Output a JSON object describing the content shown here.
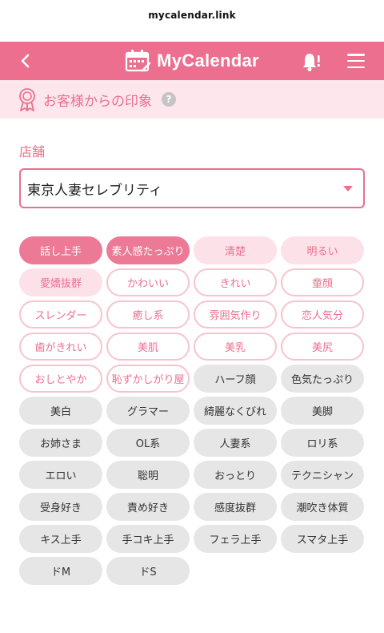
{
  "browser": {
    "url": "mycalendar.link"
  },
  "header": {
    "brand": "MyCalendar",
    "back_icon": "chevron-left-icon",
    "bell_icon": "bell-icon",
    "menu_icon": "hamburger-menu-icon"
  },
  "section": {
    "title": "お客様からの印象",
    "help": "?"
  },
  "shop": {
    "label": "店舗",
    "selected": "東京人妻セレブリティ"
  },
  "colors": {
    "accent": "#ec6f8f",
    "header_bg": "#ec6f8f",
    "section_bg": "#fde6ec",
    "chip_gray": "#e6e6e6"
  },
  "tags": [
    {
      "label": "話し上手",
      "state": "selected"
    },
    {
      "label": "素人感たっぷり",
      "state": "selected"
    },
    {
      "label": "清楚",
      "state": "soft"
    },
    {
      "label": "明るい",
      "state": "soft"
    },
    {
      "label": "愛嬌抜群",
      "state": "soft"
    },
    {
      "label": "かわいい",
      "state": "outline"
    },
    {
      "label": "きれい",
      "state": "outline"
    },
    {
      "label": "童顔",
      "state": "outline"
    },
    {
      "label": "スレンダー",
      "state": "outline"
    },
    {
      "label": "癒し系",
      "state": "outline"
    },
    {
      "label": "雰囲気作り",
      "state": "outline"
    },
    {
      "label": "恋人気分",
      "state": "outline"
    },
    {
      "label": "歯がきれい",
      "state": "outline"
    },
    {
      "label": "美肌",
      "state": "outline"
    },
    {
      "label": "美乳",
      "state": "outline"
    },
    {
      "label": "美尻",
      "state": "outline"
    },
    {
      "label": "おしとやか",
      "state": "outline"
    },
    {
      "label": "恥ずかしがり屋",
      "state": "outline"
    },
    {
      "label": "ハーフ顔",
      "state": "gray"
    },
    {
      "label": "色気たっぷり",
      "state": "gray"
    },
    {
      "label": "美白",
      "state": "gray"
    },
    {
      "label": "グラマー",
      "state": "gray"
    },
    {
      "label": "綺麗なくびれ",
      "state": "gray"
    },
    {
      "label": "美脚",
      "state": "gray"
    },
    {
      "label": "お姉さま",
      "state": "gray"
    },
    {
      "label": "OL系",
      "state": "gray"
    },
    {
      "label": "人妻系",
      "state": "gray"
    },
    {
      "label": "ロリ系",
      "state": "gray"
    },
    {
      "label": "エロい",
      "state": "gray"
    },
    {
      "label": "聡明",
      "state": "gray"
    },
    {
      "label": "おっとり",
      "state": "gray"
    },
    {
      "label": "テクニシャン",
      "state": "gray"
    },
    {
      "label": "受身好き",
      "state": "gray"
    },
    {
      "label": "責め好き",
      "state": "gray"
    },
    {
      "label": "感度抜群",
      "state": "gray"
    },
    {
      "label": "潮吹き体質",
      "state": "gray"
    },
    {
      "label": "キス上手",
      "state": "gray"
    },
    {
      "label": "手コキ上手",
      "state": "gray"
    },
    {
      "label": "フェラ上手",
      "state": "gray"
    },
    {
      "label": "スマタ上手",
      "state": "gray"
    },
    {
      "label": "ドM",
      "state": "gray"
    },
    {
      "label": "ドS",
      "state": "gray"
    }
  ]
}
